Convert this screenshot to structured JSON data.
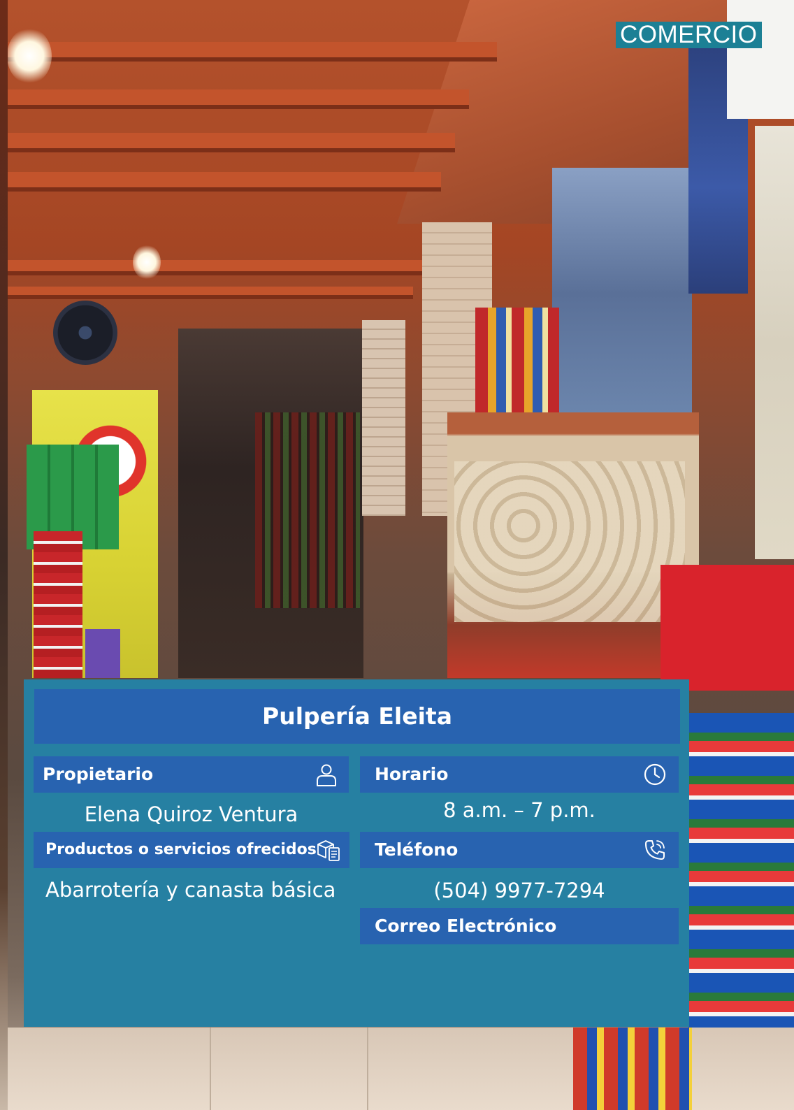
{
  "category_tag": "COMERCIO",
  "business": {
    "name": "Pulpería Eleita",
    "owner": {
      "label": "Propietario",
      "icon": "person-icon",
      "value": "Elena Quiroz Ventura"
    },
    "hours": {
      "label": "Horario",
      "icon": "clock-icon",
      "value": "8 a.m. – 7 p.m."
    },
    "products": {
      "label": "Productos o servicios ofrecidos",
      "icon": "products-icon",
      "value": "Abarrotería y canasta básica"
    },
    "phone": {
      "label": "Teléfono",
      "icon": "phone-icon",
      "value": "(504) 9977-7294"
    },
    "email": {
      "label": "Correo Electrónico",
      "value": ""
    }
  },
  "colors": {
    "panel": "#2680a2",
    "header": "#2863b0",
    "tag": "#1c8095",
    "text": "#ffffff"
  }
}
